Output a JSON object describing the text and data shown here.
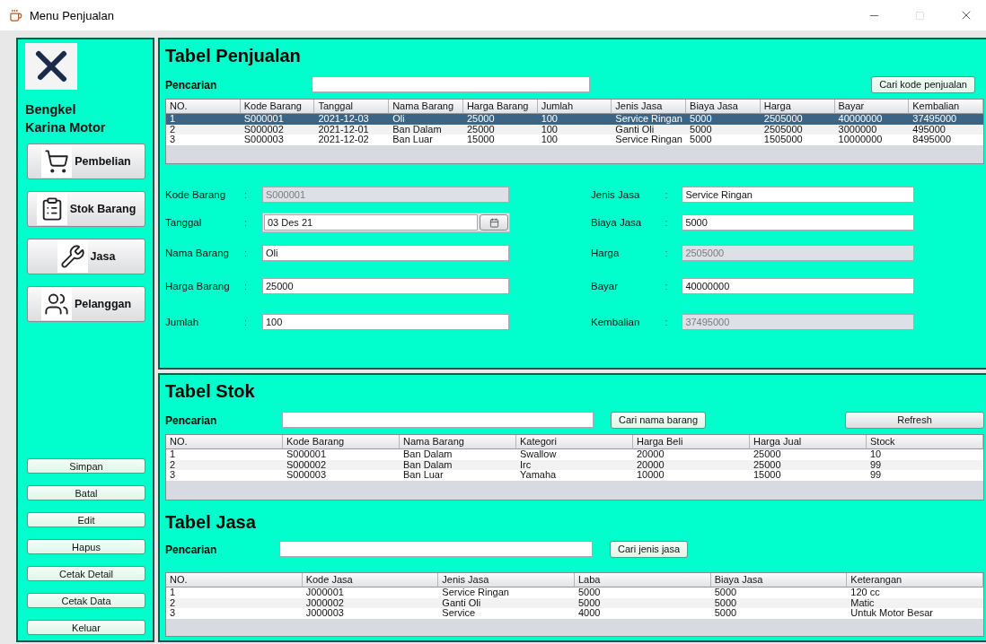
{
  "window": {
    "title": "Menu Penjualan"
  },
  "sidebar": {
    "brand_lines": [
      "Bengkel",
      "Karina Motor"
    ],
    "nav_buttons": [
      {
        "label": "Pembelian"
      },
      {
        "label": "Stok Barang"
      },
      {
        "label": "Jasa"
      },
      {
        "label": "Pelanggan"
      }
    ],
    "action_buttons": [
      "Simpan",
      "Batal",
      "Edit",
      "Hapus",
      "Cetak Detail",
      "Cetak Data",
      "Keluar"
    ]
  },
  "penjualan": {
    "title": "Tabel Penjualan",
    "search_label": "Pencarian",
    "search_button": "Cari kode penjualan",
    "table": {
      "columns": [
        "NO.",
        "Kode Barang",
        "Tanggal",
        "Nama Barang",
        "Harga Barang",
        "Jumlah",
        "Jenis Jasa",
        "Biaya Jasa",
        "Harga",
        "Bayar",
        "Kembalian"
      ],
      "rows": [
        {
          "cells": [
            "1",
            "S000001",
            "2021-12-03",
            "Oli",
            "25000",
            "100",
            "Service Ringan",
            "5000",
            "2505000",
            "40000000",
            "37495000"
          ],
          "selected": true
        },
        {
          "cells": [
            "2",
            "S000002",
            "2021-12-01",
            "Ban Dalam",
            "25000",
            "100",
            "Ganti Oli",
            "5000",
            "2505000",
            "3000000",
            "495000"
          ],
          "selected": false
        },
        {
          "cells": [
            "3",
            "S000003",
            "2021-12-02",
            "Ban Luar",
            "15000",
            "100",
            "Service Ringan",
            "5000",
            "1505000",
            "10000000",
            "8495000"
          ],
          "selected": false
        }
      ]
    },
    "form_left": [
      {
        "label": "Kode Barang",
        "separator": ":",
        "value": "S000001",
        "disabled": true,
        "kind": "text"
      },
      {
        "label": "Tanggal",
        "separator": ":",
        "value": "03 Des 21",
        "disabled": false,
        "kind": "date"
      },
      {
        "label": "Nama Barang",
        "separator": ":",
        "value": "Oli",
        "disabled": false,
        "kind": "text"
      },
      {
        "label": "Harga Barang",
        "separator": ":",
        "value": "25000",
        "disabled": false,
        "kind": "text"
      },
      {
        "label": "Jumlah",
        "separator": ":",
        "value": "100",
        "disabled": false,
        "kind": "text"
      }
    ],
    "form_right": [
      {
        "label": "Jenis Jasa",
        "separator": ":",
        "value": "Service Ringan",
        "disabled": false,
        "kind": "text"
      },
      {
        "label": "Biaya Jasa",
        "separator": ":",
        "value": "5000",
        "disabled": false,
        "kind": "text"
      },
      {
        "label": "Harga",
        "separator": ":",
        "value": "2505000",
        "disabled": true,
        "kind": "text"
      },
      {
        "label": "Bayar",
        "separator": ":",
        "value": "40000000",
        "disabled": false,
        "kind": "text"
      },
      {
        "label": "Kembalian",
        "separator": ":",
        "value": "37495000",
        "disabled": true,
        "kind": "text"
      }
    ]
  },
  "stok": {
    "title": "Tabel Stok",
    "search_label": "Pencarian",
    "search_button": "Cari nama barang",
    "refresh_button": "Refresh",
    "table": {
      "columns": [
        "NO.",
        "Kode Barang",
        "Nama Barang",
        "Kategori",
        "Harga Beli",
        "Harga Jual",
        "Stock"
      ],
      "rows": [
        {
          "cells": [
            "1",
            "S000001",
            "Ban Dalam",
            "Swallow",
            "20000",
            "25000",
            "10"
          ],
          "selected": false
        },
        {
          "cells": [
            "2",
            "S000002",
            "Ban Dalam",
            "Irc",
            "20000",
            "25000",
            "99"
          ],
          "selected": false
        },
        {
          "cells": [
            "3",
            "S000003",
            "Ban Luar",
            "Yamaha",
            "10000",
            "15000",
            "99"
          ],
          "selected": false
        }
      ]
    }
  },
  "jasa": {
    "title": "Tabel Jasa",
    "search_label": "Pencarian",
    "search_button": "Cari jenis jasa",
    "table": {
      "columns": [
        "NO.",
        "Kode Jasa",
        "Jenis Jasa",
        "Laba",
        "Biaya Jasa",
        "Keterangan"
      ],
      "rows": [
        {
          "cells": [
            "1",
            "J000001",
            "Service Ringan",
            "5000",
            "5000",
            "120 cc"
          ],
          "selected": false
        },
        {
          "cells": [
            "2",
            "J000002",
            "Ganti Oli",
            "5000",
            "5000",
            "Matic"
          ],
          "selected": false
        },
        {
          "cells": [
            "3",
            "J000003",
            "Service",
            "4000",
            "5000",
            "Untuk Motor Besar"
          ],
          "selected": false
        }
      ]
    }
  }
}
